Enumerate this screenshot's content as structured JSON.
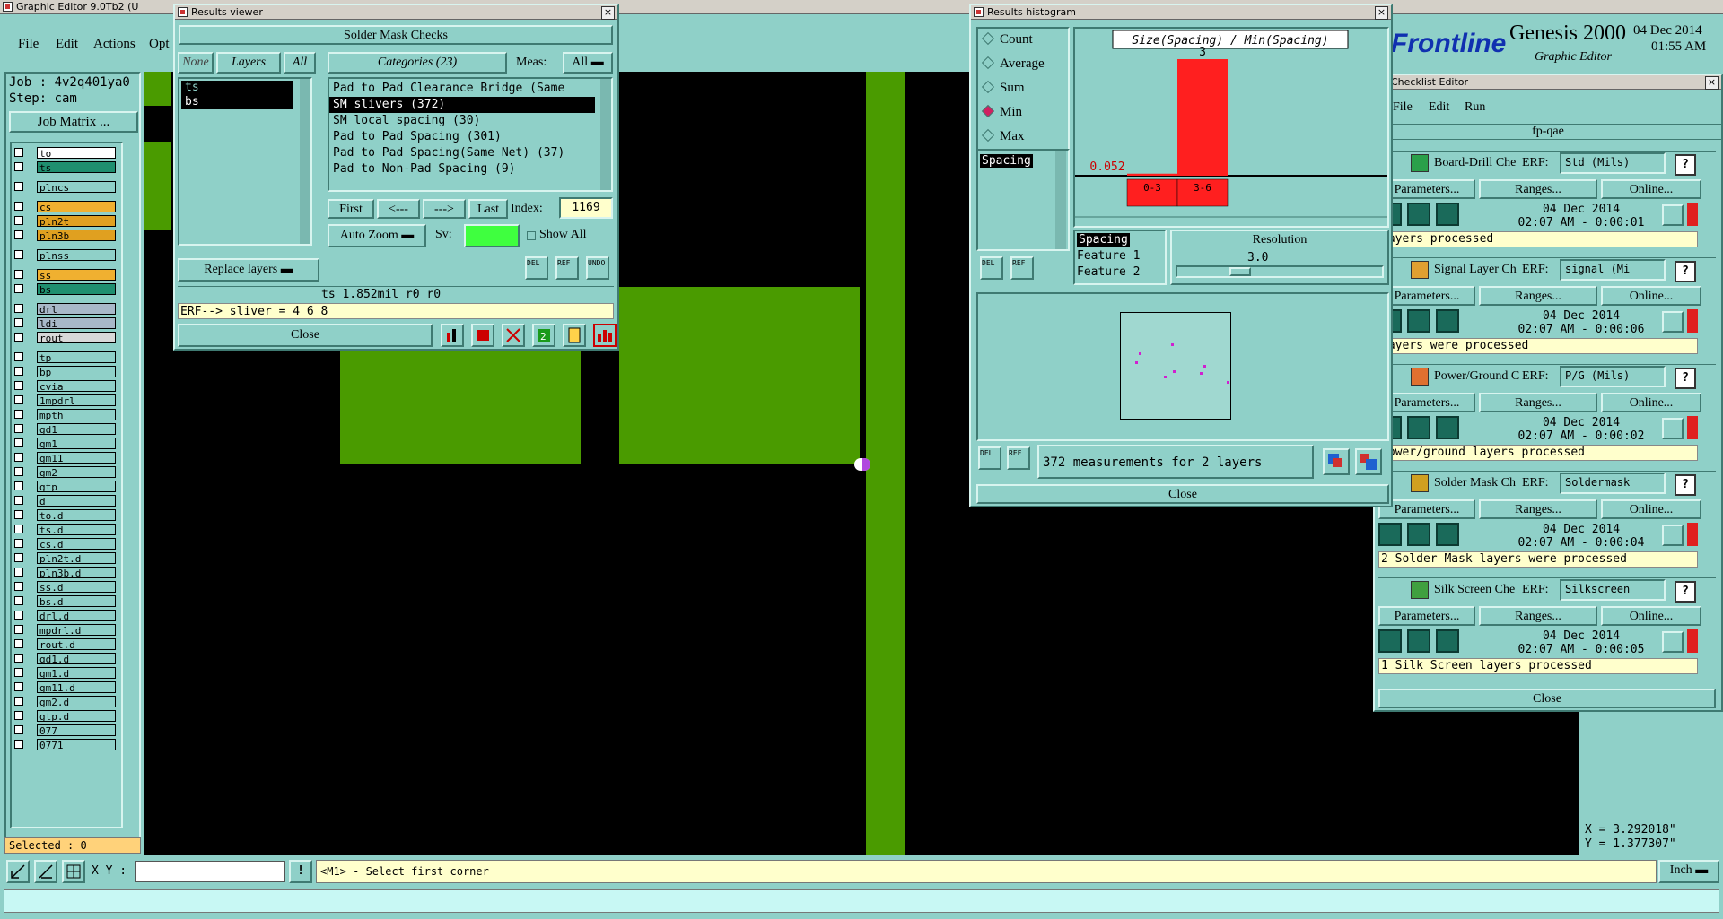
{
  "main": {
    "title": "Graphic Editor 9.0Tb2 (U",
    "menu": [
      "File",
      "Edit",
      "Actions",
      "Opt"
    ],
    "job": "Job : 4v2q401ya0",
    "step": "Step: cam",
    "job_matrix": "Job Matrix ...",
    "selected": "Selected : 0",
    "xy_label": "X Y :",
    "xy_value": "",
    "prompt": "<M1> - Select first corner",
    "units": "Inch",
    "coord_x": "X = 3.292018\"",
    "coord_y": "Y = 1.377307\""
  },
  "layers": [
    {
      "name": "to",
      "color": "#ffffff",
      "group": 0
    },
    {
      "name": "ts",
      "color": "#1f8f6f",
      "group": 0
    },
    {
      "name": "plncs",
      "color": "#8fd0c8",
      "group": 1
    },
    {
      "name": "cs",
      "color": "#f0b030",
      "group": 2
    },
    {
      "name": "pln2t",
      "color": "#e0a020",
      "group": 2
    },
    {
      "name": "pln3b",
      "color": "#e0a020",
      "group": 2
    },
    {
      "name": "plnss",
      "color": "#8fd0c8",
      "group": 3
    },
    {
      "name": "ss",
      "color": "#f0b030",
      "group": 4
    },
    {
      "name": "bs",
      "color": "#1f8f6f",
      "group": 4
    },
    {
      "name": "drl",
      "color": "#a8b8c8",
      "group": 5
    },
    {
      "name": "ldi",
      "color": "#a8b8c8",
      "group": 5
    },
    {
      "name": "rout",
      "color": "#d8d8d8",
      "group": 5
    },
    {
      "name": "tp",
      "color": "#8fd0c8",
      "group": 6
    },
    {
      "name": "bp",
      "color": "#8fd0c8",
      "group": 6
    },
    {
      "name": "cvia",
      "color": "#8fd0c8",
      "group": 6
    },
    {
      "name": "1mpdrl",
      "color": "#8fd0c8",
      "group": 6
    },
    {
      "name": "mpth",
      "color": "#8fd0c8",
      "group": 6
    },
    {
      "name": "gd1",
      "color": "#8fd0c8",
      "group": 6
    },
    {
      "name": "gm1",
      "color": "#8fd0c8",
      "group": 6
    },
    {
      "name": "gm11",
      "color": "#8fd0c8",
      "group": 6
    },
    {
      "name": "gm2",
      "color": "#8fd0c8",
      "group": 6
    },
    {
      "name": "gtp",
      "color": "#8fd0c8",
      "group": 6
    },
    {
      "name": "d",
      "color": "#8fd0c8",
      "group": 6
    },
    {
      "name": "to.d",
      "color": "#8fd0c8",
      "group": 6
    },
    {
      "name": "ts.d",
      "color": "#8fd0c8",
      "group": 6
    },
    {
      "name": "cs.d",
      "color": "#8fd0c8",
      "group": 6
    },
    {
      "name": "pln2t.d",
      "color": "#8fd0c8",
      "group": 6
    },
    {
      "name": "pln3b.d",
      "color": "#8fd0c8",
      "group": 6
    },
    {
      "name": "ss.d",
      "color": "#8fd0c8",
      "group": 6
    },
    {
      "name": "bs.d",
      "color": "#8fd0c8",
      "group": 6
    },
    {
      "name": "drl.d",
      "color": "#8fd0c8",
      "group": 6
    },
    {
      "name": "mpdrl.d",
      "color": "#8fd0c8",
      "group": 6
    },
    {
      "name": "rout.d",
      "color": "#8fd0c8",
      "group": 6
    },
    {
      "name": "gd1.d",
      "color": "#8fd0c8",
      "group": 6
    },
    {
      "name": "gm1.d",
      "color": "#8fd0c8",
      "group": 6
    },
    {
      "name": "gm11.d",
      "color": "#8fd0c8",
      "group": 6
    },
    {
      "name": "gm2.d",
      "color": "#8fd0c8",
      "group": 6
    },
    {
      "name": "gtp.d",
      "color": "#8fd0c8",
      "group": 6
    },
    {
      "name": "077",
      "color": "#8fd0c8",
      "group": 6
    },
    {
      "name": "0771",
      "color": "#8fd0c8",
      "group": 6
    }
  ],
  "results_viewer": {
    "title": "Results viewer",
    "header": "Solder Mask Checks",
    "none": "None",
    "layers": "Layers",
    "all": "All",
    "categories": "Categories (23)",
    "meas": "Meas:",
    "meas_value": "All",
    "layer_items": [
      "ts",
      "bs"
    ],
    "category_items": [
      "Pad to Pad Clearance Bridge (Same",
      "SM slivers (372)",
      "SM local spacing (30)",
      "Pad to Pad Spacing (301)",
      "Pad to Pad Spacing(Same Net) (37)",
      "Pad to Non-Pad Spacing (9)"
    ],
    "selected_category": 1,
    "first": "First",
    "prev": "<---",
    "next": "--->",
    "last": "Last",
    "index_label": "Index:",
    "index_value": "1169",
    "auto_zoom": "Auto Zoom",
    "sv": "Sv:",
    "show_all": "Show All",
    "replace_layers": "Replace layers",
    "del": "DEL",
    "ref": "REF",
    "undo": "UNDO",
    "status": "ts 1.852mil  r0  r0",
    "erf": "ERF--> sliver = 4 6 8",
    "close": "Close"
  },
  "histogram": {
    "title": "Results histogram",
    "options": [
      "Count",
      "Average",
      "Sum",
      "Min",
      "Max"
    ],
    "selected_option": "Min",
    "chart_title": "Size(Spacing) / Min(Spacing)",
    "list_item": "Spacing",
    "fields": [
      "Spacing",
      "Feature 1",
      "Feature 2"
    ],
    "resolution_label": "Resolution",
    "resolution_value": "3.0",
    "measurements": "372 measurements for 2 layers",
    "close": "Close",
    "chart_data": {
      "type": "bar",
      "categories": [
        "0-3",
        "3-6"
      ],
      "values": [
        0.052,
        3
      ],
      "value_labels": [
        "0.052",
        "3"
      ],
      "title": "Size(Spacing) / Min(Spacing)",
      "bar_color": "#ff1f1f"
    }
  },
  "genesis": {
    "brand": "Frontline",
    "product": "Genesis 2000",
    "subtitle": "Graphic Editor",
    "date": "04 Dec 2014",
    "time": "01:55 AM"
  },
  "checklist": {
    "title": "Checklist Editor",
    "menu": [
      "File",
      "Edit",
      "Run"
    ],
    "name": "fp-qae",
    "erf_label": "ERF:",
    "params": "Parameters...",
    "ranges": "Ranges...",
    "online": "Online...",
    "close": "Close",
    "items": [
      {
        "name": "Board-Drill Che",
        "erf": "Std (Mils)",
        "date": "04 Dec 2014",
        "time": "02:07 AM - 0:00:01",
        "msg": "layers processed",
        "icon_color": "#2aa04a"
      },
      {
        "name": "Signal Layer Ch",
        "erf": "signal (Mi",
        "date": "04 Dec 2014",
        "time": "02:07 AM - 0:00:06",
        "msg": "layers were processed",
        "icon_color": "#e0a030"
      },
      {
        "name": "Power/Ground C",
        "erf": "P/G (Mils)",
        "date": "04 Dec 2014",
        "time": "02:07 AM - 0:00:02",
        "msg": "power/ground layers processed",
        "icon_color": "#e07030"
      },
      {
        "name": "Solder Mask Ch",
        "erf": "Soldermask",
        "date": "04 Dec 2014",
        "time": "02:07 AM - 0:00:04",
        "msg": "2 Solder Mask layers were processed",
        "icon_color": "#d0a020"
      },
      {
        "name": "Silk Screen Che",
        "erf": "Silkscreen",
        "date": "04 Dec 2014",
        "time": "02:07 AM - 0:00:05",
        "msg": "1 Silk Screen layers processed",
        "icon_color": "#40a040"
      }
    ]
  }
}
